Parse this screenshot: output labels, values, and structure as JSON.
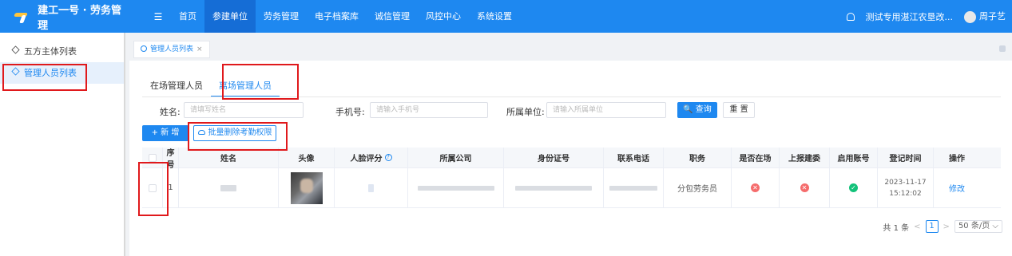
{
  "header": {
    "app_title": "建工一号 · 劳务管理",
    "menu_toggle": "☰",
    "nav": [
      "首页",
      "参建单位",
      "劳务管理",
      "电子档案库",
      "诚信管理",
      "风控中心",
      "系统设置"
    ],
    "active_nav": "参建单位",
    "org_name": "测试专用湛江农垦改...",
    "user_name": "周子艺"
  },
  "sidebar": {
    "items": [
      {
        "label": "五方主体列表",
        "active": false
      },
      {
        "label": "管理人员列表",
        "active": true
      }
    ]
  },
  "page_tab": {
    "label": "管理人员列表",
    "close": "×"
  },
  "subtabs": {
    "items": [
      "在场管理人员",
      "离场管理人员"
    ],
    "active": "离场管理人员"
  },
  "search": {
    "name_label": "姓名:",
    "name_placeholder": "请填写姓名",
    "phone_label": "手机号:",
    "phone_placeholder": "请输入手机号",
    "company_label": "所属单位:",
    "company_placeholder": "请输入所属单位",
    "query_label": "🔍 查询",
    "reset_label": "重 置"
  },
  "actions": {
    "add_label": "+ 新 增",
    "batch_delete_label": "批量删除考勤权限"
  },
  "table": {
    "columns": [
      "序号",
      "姓名",
      "头像",
      "人脸评分",
      "所属公司",
      "身份证号",
      "联系电话",
      "职务",
      "是否在场",
      "上报建委",
      "启用账号",
      "登记时间",
      "操作"
    ],
    "rows": [
      {
        "index": "1",
        "position": "分包劳务员",
        "on_site": false,
        "reported": false,
        "account_enabled": true,
        "reg_date": "2023-11-17",
        "reg_time": "15:12:02",
        "action": "修改"
      }
    ]
  },
  "pagination": {
    "total": "共 1 条",
    "current_page": "1",
    "page_size": "50 条/页"
  },
  "colors": {
    "primary": "#1e88f0",
    "danger": "#f56c6c",
    "success": "#13c27a",
    "annotation": "#e0191c"
  }
}
